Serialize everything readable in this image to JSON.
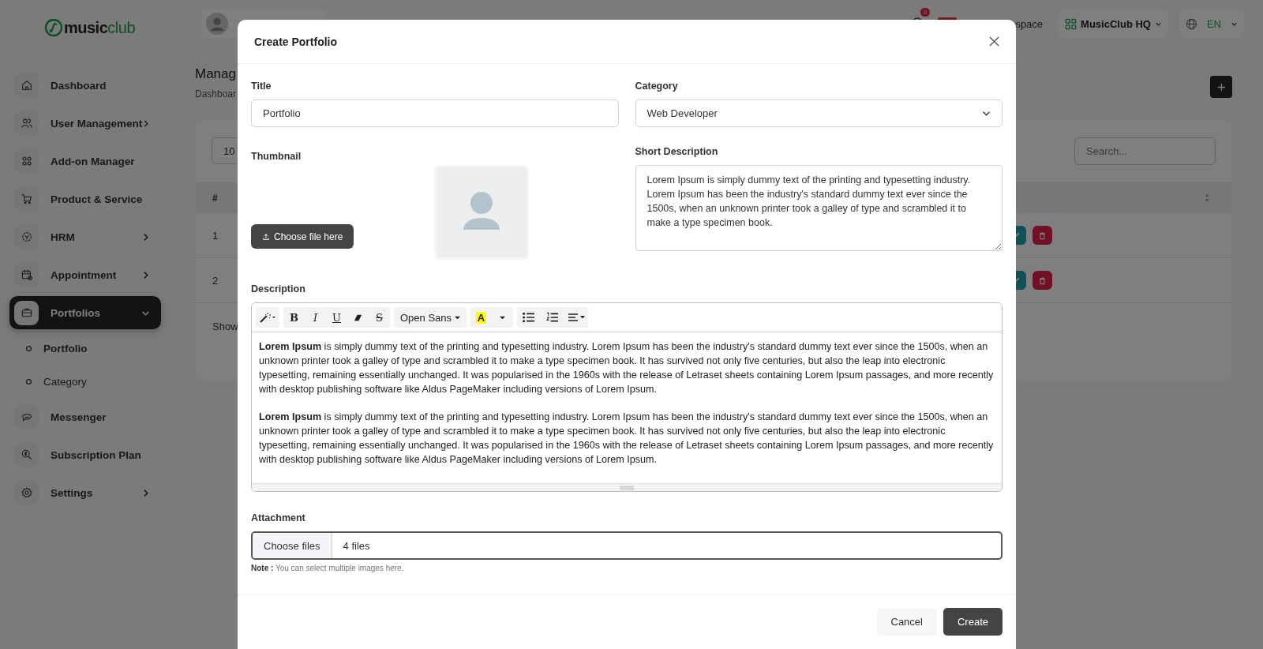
{
  "logo": {
    "parts": [
      "music",
      "club"
    ]
  },
  "header": {
    "notification_count": "0",
    "workspace_label": "space",
    "company": "MusicClub HQ",
    "language": "EN"
  },
  "sidebar": {
    "items": [
      {
        "label": "Dashboard",
        "selected": false
      },
      {
        "label": "User Management",
        "selected": false,
        "expanded": false
      },
      {
        "label": "Add-on Manager",
        "selected": false
      },
      {
        "label": "Product & Service",
        "selected": false
      },
      {
        "label": "HRM",
        "selected": false,
        "expanded": false
      },
      {
        "label": "Appointment",
        "selected": false,
        "expanded": false
      },
      {
        "label": "Portfolios",
        "selected": true,
        "expanded": true,
        "children": [
          {
            "label": "Portfolio",
            "selected": true
          },
          {
            "label": "Category",
            "selected": false
          }
        ]
      },
      {
        "label": "Messenger",
        "selected": false
      },
      {
        "label": "Subscription Plan",
        "selected": false
      },
      {
        "label": "Settings",
        "selected": false,
        "expanded": false
      }
    ]
  },
  "page": {
    "title": "Manag",
    "breadcrumb": "Dashboar"
  },
  "table": {
    "page_size": "10",
    "search_placeholder": "Search...",
    "columns": [
      "#"
    ],
    "rows": [
      {
        "number": "1"
      },
      {
        "number": "2"
      }
    ],
    "footer": "Show"
  },
  "modal": {
    "title": "Create Portfolio",
    "title_label": "Title",
    "title_value": "Portfolio",
    "category_label": "Category",
    "category_value": "Web Developer",
    "thumbnail_label": "Thumbnail",
    "thumbnail_button": "Choose file here",
    "short_description_label": "Short Description",
    "short_description_value": "Lorem Ipsum is simply dummy text of the printing and typesetting industry. Lorem Ipsum has been the industry's standard dummy text ever since the 1500s, when an unknown printer took a galley of type and scrambled it to make a type specimen book.",
    "description_label": "Description",
    "toolbar": [
      [
        {
          "kind": "wand"
        }
      ],
      [
        {
          "kind": "bold",
          "label": "B"
        },
        {
          "kind": "italic",
          "label": "I"
        },
        {
          "kind": "underline",
          "label": "U"
        },
        {
          "kind": "eraser"
        },
        {
          "kind": "strike",
          "label": "S"
        }
      ],
      [
        {
          "kind": "font",
          "label": "Open Sans"
        }
      ],
      [
        {
          "kind": "color",
          "label": "A"
        }
      ],
      [
        {
          "kind": "ul"
        },
        {
          "kind": "ol"
        },
        {
          "kind": "align"
        }
      ]
    ],
    "description_paragraphs": [
      "**Lorem Ipsum** is simply dummy text of the printing and typesetting industry. Lorem Ipsum has been the industry's standard dummy text ever since the 1500s, when an unknown printer took a galley of type and scrambled it to make a type specimen book. It has survived not only five centuries, but also the leap into electronic typesetting, remaining essentially unchanged. It was popularised in the 1960s with the release of Letraset sheets containing Lorem Ipsum passages, and more recently with desktop publishing software like Aldus PageMaker including versions of Lorem Ipsum.",
      "**Lorem Ipsum** is simply dummy text of the printing and typesetting industry. Lorem Ipsum has been the industry's standard dummy text ever since the 1500s, when an unknown printer took a galley of type and scrambled it to make a type specimen book. It has survived not only five centuries, but also the leap into electronic typesetting, remaining essentially unchanged. It was popularised in the 1960s with the release of Letraset sheets containing Lorem Ipsum passages, and more recently with desktop publishing software like Aldus PageMaker including versions of Lorem Ipsum."
    ],
    "attachment_label": "Attachment",
    "attachment_button": "Choose files",
    "attachment_value": "4 files",
    "note": "**Note :** You can select multiple images here.",
    "buttons": [
      {
        "label": "Cancel",
        "kind": "secondary"
      },
      {
        "label": "Create",
        "kind": "primary"
      }
    ]
  }
}
